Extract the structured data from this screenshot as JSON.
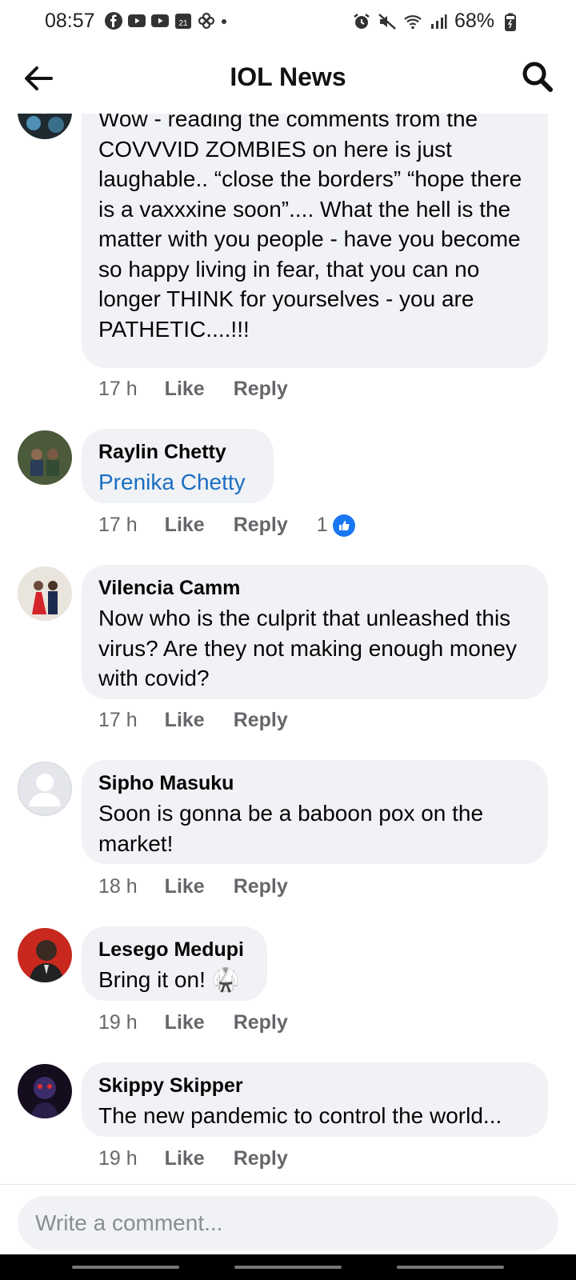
{
  "status_bar": {
    "time": "08:57",
    "battery": "68%",
    "calendar_day": "21"
  },
  "header": {
    "title": "IOL News"
  },
  "comments": [
    {
      "author": "",
      "text": "Wow - reading the comments from the COVVVID ZOMBIES on here is just laughable.. “close the borders” “hope there is a vaxxxine soon”.... What the hell is the matter with you people - have you become so happy living in fear, that you can no longer THINK for yourselves - you are PATHETIC....!!!",
      "time": "17 h",
      "like": "Like",
      "reply": "Reply"
    },
    {
      "author": "Raylin Chetty",
      "text": "Prenika Chetty",
      "time": "17 h",
      "like": "Like",
      "reply": "Reply",
      "reaction_count": "1"
    },
    {
      "author": "Vilencia Camm",
      "text": "Now who is the culprit that unleashed this virus? Are they not making enough money with covid?",
      "time": "17 h",
      "like": "Like",
      "reply": "Reply"
    },
    {
      "author": "Sipho Masuku",
      "text": "Soon is gonna be a baboon pox on the market!",
      "time": "18 h",
      "like": "Like",
      "reply": "Reply"
    },
    {
      "author": "Lesego Medupi",
      "text": "Bring it on! 🥋",
      "time": "19 h",
      "like": "Like",
      "reply": "Reply"
    },
    {
      "author": "Skippy Skipper",
      "text": "The new pandemic to control the world...",
      "time": "19 h",
      "like": "Like",
      "reply": "Reply"
    }
  ],
  "composer": {
    "placeholder": "Write a comment..."
  },
  "colors": {
    "bubble": "#f0f2f5",
    "link": "#1b6ec2",
    "like_blue": "#1877f2",
    "meta_gray": "#65676b"
  }
}
